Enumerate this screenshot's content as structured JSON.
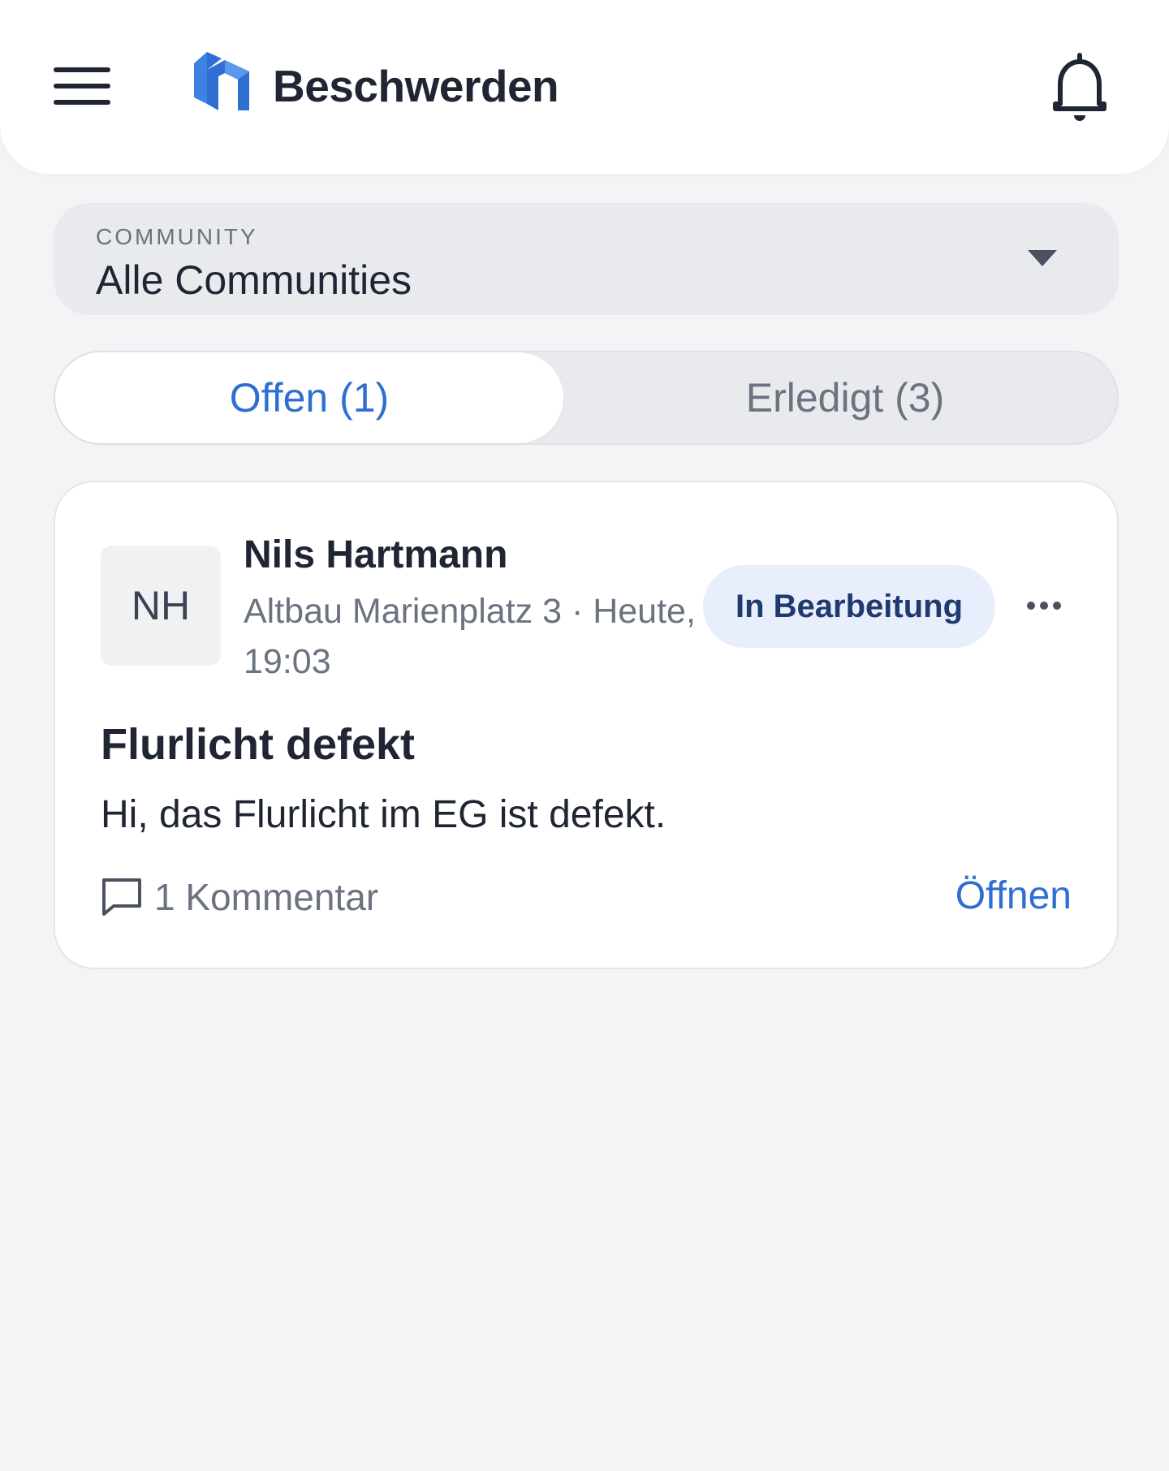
{
  "header": {
    "title": "Beschwerden",
    "menu_icon": "hamburger-menu-icon",
    "logo": "house-logo",
    "bell_icon": "bell-icon",
    "accent_color": "#2f6fd1"
  },
  "community": {
    "label": "COMMUNITY",
    "value": "Alle Communities",
    "icon": "caret-down-icon"
  },
  "tabs": [
    {
      "label": "Offen (1)",
      "active": true
    },
    {
      "label": "Erledigt (3)",
      "active": false
    }
  ],
  "complaints": [
    {
      "initials": "NH",
      "author": "Nils Hartmann",
      "meta": "Altbau Marienplatz 3 · Heute, 19:03",
      "status": "In Bearbeitung",
      "status_color": "#1e3a6e",
      "status_bg": "#e8eefb",
      "title": "Flurlicht defekt",
      "body": "Hi, das Flurlicht im EG ist defekt.",
      "comments": "1 Kommentar",
      "comment_icon": "comment-icon",
      "more_icon": "more-horizontal-icon",
      "open_label": "Öffnen"
    }
  ]
}
